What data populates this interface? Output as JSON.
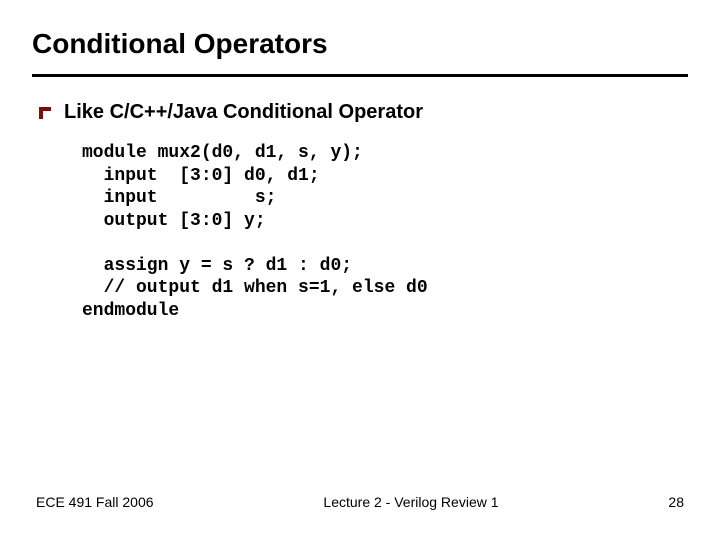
{
  "title": "Conditional Operators",
  "bullet": {
    "text": "Like C/C++/Java Conditional Operator"
  },
  "code": "module mux2(d0, d1, s, y);\n  input  [3:0] d0, d1;\n  input         s;\n  output [3:0] y;\n\n  assign y = s ? d1 : d0;\n  // output d1 when s=1, else d0\nendmodule",
  "footer": {
    "left": "ECE 491 Fall 2006",
    "center": "Lecture 2 - Verilog Review 1",
    "page": "28"
  },
  "theme": {
    "maroon": "#7a0d0d"
  }
}
